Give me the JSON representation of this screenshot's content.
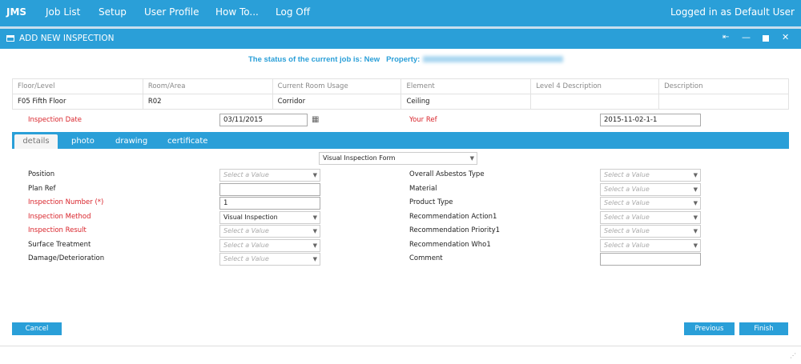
{
  "nav": {
    "brand": "JMS",
    "items": [
      "Job List",
      "Setup",
      "User Profile",
      "How To...",
      "Log Off"
    ],
    "user": "Logged in as Default User"
  },
  "window": {
    "title": "ADD NEW INSPECTION"
  },
  "status": {
    "text": "The status of the current job is: New",
    "property_label": "Property:"
  },
  "table": {
    "headers": [
      "Floor/Level",
      "Room/Area",
      "Current Room Usage",
      "Element",
      "Level 4 Description",
      "Description"
    ],
    "values": [
      "F05 Fifth Floor",
      "R02",
      "Corridor",
      "Ceiling",
      "",
      ""
    ]
  },
  "inspection_date": {
    "label": "Inspection Date",
    "value": "03/11/2015"
  },
  "your_ref": {
    "label": "Your Ref",
    "value": "2015-11-02-1-1"
  },
  "tabs": [
    "details",
    "photo",
    "drawing",
    "certificate"
  ],
  "form_type": "Visual Inspection Form",
  "placeholder": "Select a Value",
  "left_fields": [
    {
      "label": "Position",
      "type": "select",
      "value": ""
    },
    {
      "label": "Plan Ref",
      "type": "text",
      "value": ""
    },
    {
      "label": "Inspection Number (*)",
      "type": "text",
      "value": "1",
      "required": true
    },
    {
      "label": "Inspection Method",
      "type": "select",
      "value": "Visual Inspection",
      "required": true
    },
    {
      "label": "Inspection Result",
      "type": "select",
      "value": "",
      "required": true
    },
    {
      "label": "Surface Treatment",
      "type": "select",
      "value": ""
    },
    {
      "label": "Damage/Deterioration",
      "type": "select",
      "value": ""
    }
  ],
  "right_fields": [
    {
      "label": "Overall Asbestos Type",
      "type": "select",
      "value": ""
    },
    {
      "label": "Material",
      "type": "select",
      "value": ""
    },
    {
      "label": "Product Type",
      "type": "select",
      "value": ""
    },
    {
      "label": "Recommendation Action1",
      "type": "select",
      "value": ""
    },
    {
      "label": "Recommendation Priority1",
      "type": "select",
      "value": ""
    },
    {
      "label": "Recommendation Who1",
      "type": "select",
      "value": ""
    },
    {
      "label": "Comment",
      "type": "text",
      "value": ""
    }
  ],
  "buttons": {
    "cancel": "Cancel",
    "previous": "Previous",
    "finish": "Finish"
  }
}
